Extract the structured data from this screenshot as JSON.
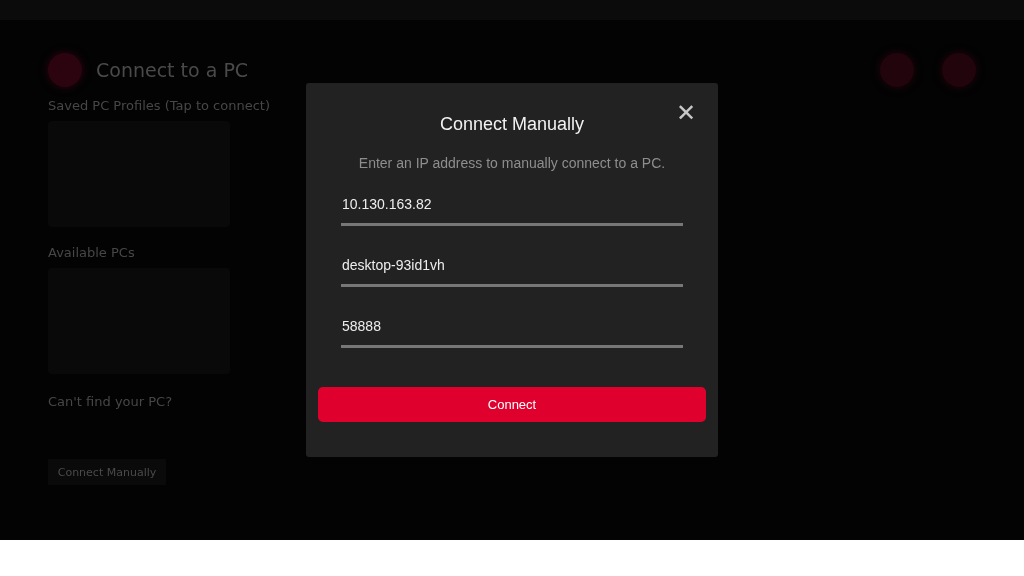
{
  "page": {
    "title": "Connect to a PC",
    "saved_heading": "Saved PC Profiles (Tap to connect)",
    "available_heading": "Available PCs",
    "help_heading": "Can't find your PC?",
    "help_button": "Connect Manually"
  },
  "dialog": {
    "title": "Connect Manually",
    "close": "✕",
    "subtitle": "Enter an IP address to manually connect to a PC.",
    "fields": [
      {
        "value": "10.130.163.82"
      },
      {
        "value": "desktop-93id1vh"
      },
      {
        "value": "58888"
      }
    ],
    "button": "Connect"
  }
}
